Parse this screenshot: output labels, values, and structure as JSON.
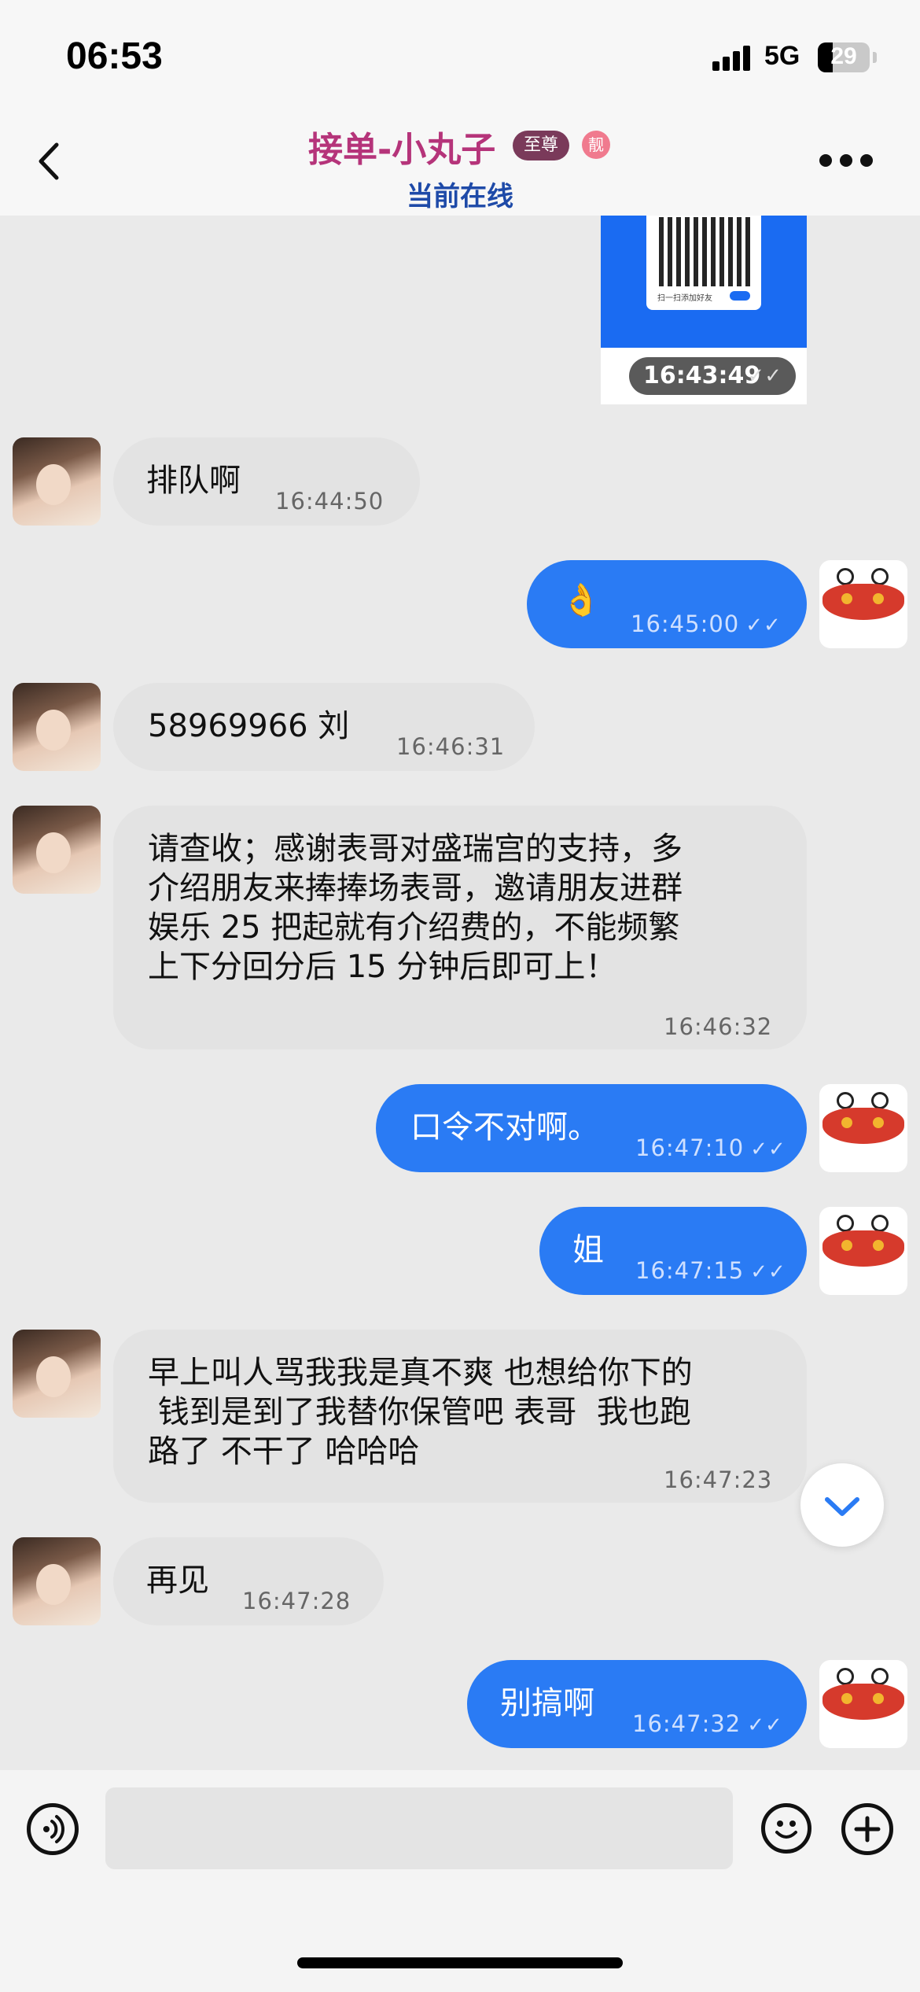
{
  "status_bar": {
    "time": "06:53",
    "network": "5G",
    "battery": "29",
    "battery_level": 0.29
  },
  "header": {
    "title": "接单-小丸子",
    "vip_badge": "至尊",
    "liang_badge": "靓",
    "subtitle": "当前在线",
    "back_icon": "chevron-left-icon",
    "more_icon": "more-dots-icon"
  },
  "messages": [
    {
      "side": "out",
      "kind": "image",
      "time": "16:43:49",
      "ticks": "✓✓",
      "image_caption": "扫一扫添加好友",
      "image_tag": "好友"
    },
    {
      "side": "in",
      "text": "排队啊",
      "time": "16:44:50"
    },
    {
      "side": "out",
      "text": "👌",
      "time": "16:45:00",
      "ticks": "✓✓"
    },
    {
      "side": "in",
      "text": "58969966 刘",
      "time": "16:46:31"
    },
    {
      "side": "in",
      "lines": [
        "请查收；感谢表哥对盛瑞宫的支持，多",
        "介绍朋友来捧捧场表哥，邀请朋友进群",
        "娱乐 25 把起就有介绍费的，不能频繁",
        "上下分回分后 15 分钟后即可上！"
      ],
      "time": "16:46:32"
    },
    {
      "side": "out",
      "text": "口令不对啊。",
      "time": "16:47:10",
      "ticks": "✓✓"
    },
    {
      "side": "out",
      "text": "姐",
      "time": "16:47:15",
      "ticks": "✓✓"
    },
    {
      "side": "in",
      "lines": [
        "早上叫人骂我我是真不爽 也想给你下的",
        " 钱到是到了我替你保管吧 表哥  我也跑",
        "路了 不干了 哈哈哈"
      ],
      "time": "16:47:23"
    },
    {
      "side": "in",
      "text": "再见",
      "time": "16:47:28"
    },
    {
      "side": "out",
      "text": "别搞啊",
      "time": "16:47:32",
      "ticks": "✓✓"
    }
  ],
  "input_bar": {
    "placeholder": "",
    "voice_icon": "voice-icon",
    "emoji_icon": "emoji-icon",
    "plus_icon": "plus-icon"
  },
  "scroll_icon": "chevron-down-icon",
  "colors": {
    "outgoing_bubble": "#2a7bf4",
    "incoming_bubble": "#e3e3e3",
    "title": "#b5347a",
    "subtitle": "#1e4aa8"
  }
}
